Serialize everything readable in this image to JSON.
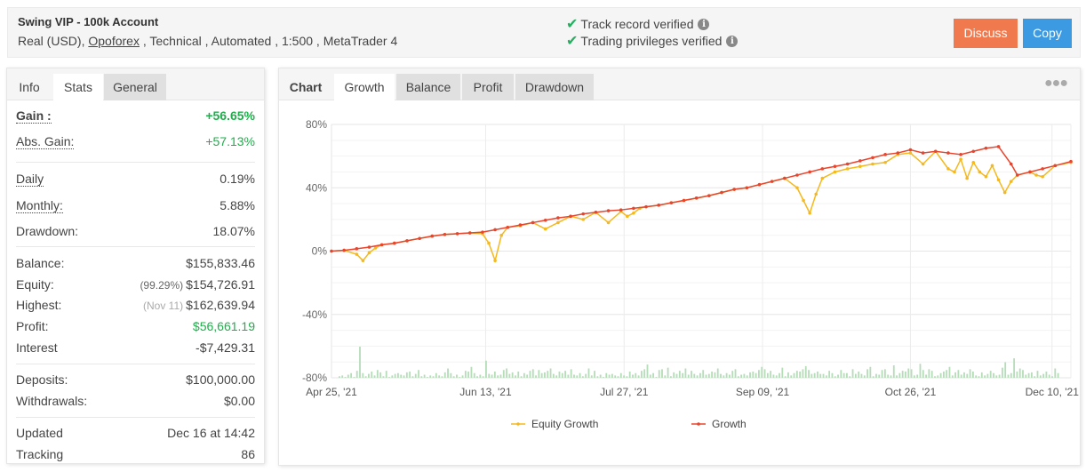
{
  "header": {
    "title": "Swing VIP - 100k Account",
    "subtitle_prefix": "Real (USD), ",
    "broker": "Opoforex",
    "subtitle_suffix": " , Technical , Automated , 1:500 , MetaTrader 4",
    "verifications": [
      {
        "label": "Track record verified",
        "icon": "check-icon"
      },
      {
        "label": "Trading privileges verified",
        "icon": "check-icon"
      }
    ],
    "discuss_label": "Discuss",
    "copy_label": "Copy",
    "colors": {
      "discuss": "#f07a4e",
      "copy": "#3b9ae1",
      "check": "#27ae60"
    }
  },
  "stats_panel": {
    "tabs": [
      {
        "label": "Info",
        "state": "label"
      },
      {
        "label": "Stats",
        "state": "active"
      },
      {
        "label": "General",
        "state": "inactive"
      }
    ],
    "gain": {
      "label": "Gain :",
      "value": "+56.65%"
    },
    "abs_gain": {
      "label": "Abs. Gain:",
      "value": "+57.13%"
    },
    "daily": {
      "label": "Daily",
      "value": "0.19%"
    },
    "monthly": {
      "label": "Monthly:",
      "value": "5.88%"
    },
    "drawdown": {
      "label": "Drawdown:",
      "value": "18.07%"
    },
    "balance": {
      "label": "Balance:",
      "value": "$155,833.46"
    },
    "equity": {
      "label": "Equity:",
      "note": "(99.29%)",
      "value": "$154,726.91"
    },
    "highest": {
      "label": "Highest:",
      "note": "(Nov 11)",
      "value": "$162,639.94"
    },
    "profit": {
      "label": "Profit:",
      "value": "$56,661.19"
    },
    "interest": {
      "label": "Interest",
      "value": "-$7,429.31"
    },
    "deposits": {
      "label": "Deposits:",
      "value": "$100,000.00"
    },
    "withdrawals": {
      "label": "Withdrawals:",
      "value": "$0.00"
    },
    "updated": {
      "label": "Updated",
      "value": "Dec 16 at 14:42"
    },
    "tracking": {
      "label": "Tracking",
      "value": "86"
    }
  },
  "chart_panel": {
    "tabs": [
      {
        "label": "Chart",
        "state": "label"
      },
      {
        "label": "Growth",
        "state": "active"
      },
      {
        "label": "Balance",
        "state": "inactive"
      },
      {
        "label": "Profit",
        "state": "inactive"
      },
      {
        "label": "Drawdown",
        "state": "inactive"
      }
    ],
    "more_icon": "ellipsis-icon"
  },
  "chart_data": {
    "type": "line",
    "title": "",
    "xlabel": "",
    "ylabel": "",
    "ylim": [
      -80,
      80
    ],
    "yticks": [
      "80%",
      "40%",
      "0%",
      "-40%",
      "-80%"
    ],
    "ytick_values": [
      80,
      40,
      0,
      -40,
      -80
    ],
    "xticks": [
      "Apr 25, '21",
      "Jun 13, '21",
      "Jul 27, '21",
      "Sep 09, '21",
      "Oct 26, '21",
      "Dec 10, '21"
    ],
    "xtick_days": [
      0,
      49,
      93,
      137,
      184,
      229
    ],
    "x_range_days": [
      0,
      235
    ],
    "grid": true,
    "legend": {
      "position": "bottom",
      "entries": [
        {
          "name": "Equity Growth",
          "color": "#f5b91e"
        },
        {
          "name": "Growth",
          "color": "#e8452e"
        }
      ]
    },
    "series": [
      {
        "name": "Growth",
        "color": "#e8452e",
        "x_days": [
          0,
          4,
          8,
          12,
          16,
          20,
          24,
          28,
          32,
          36,
          40,
          44,
          48,
          52,
          56,
          60,
          64,
          68,
          72,
          76,
          80,
          84,
          88,
          92,
          96,
          100,
          104,
          108,
          112,
          116,
          120,
          124,
          128,
          132,
          136,
          140,
          144,
          148,
          152,
          156,
          160,
          164,
          168,
          172,
          176,
          180,
          184,
          188,
          192,
          196,
          200,
          204,
          208,
          212,
          216,
          218,
          222,
          226,
          230,
          235
        ],
        "values": [
          0,
          0.5,
          1.5,
          2.5,
          4,
          5,
          6.5,
          8,
          9.5,
          10.5,
          11,
          11.5,
          12,
          13.5,
          15,
          16.5,
          18,
          19.5,
          21,
          22,
          23.5,
          24.5,
          25.5,
          26,
          27,
          28,
          29,
          30.5,
          32,
          33.5,
          35,
          37,
          39,
          40,
          42,
          44,
          46,
          48,
          50,
          52,
          53.5,
          55,
          57,
          59,
          61,
          62,
          64,
          62,
          63,
          62,
          61,
          63,
          65,
          66,
          55,
          48,
          50,
          52,
          54,
          56.6
        ]
      },
      {
        "name": "Equity Growth",
        "color": "#f5b91e",
        "x_days": [
          0,
          4,
          8,
          10,
          12,
          14,
          16,
          20,
          24,
          28,
          32,
          36,
          40,
          44,
          48,
          50,
          52,
          54,
          56,
          60,
          64,
          68,
          72,
          76,
          80,
          84,
          88,
          92,
          94,
          96,
          98,
          100,
          104,
          108,
          112,
          116,
          120,
          124,
          128,
          132,
          136,
          140,
          144,
          148,
          150,
          152,
          154,
          156,
          160,
          164,
          168,
          172,
          176,
          180,
          184,
          188,
          192,
          196,
          198,
          200,
          202,
          204,
          206,
          208,
          210,
          212,
          214,
          216,
          218,
          222,
          224,
          226,
          230,
          235
        ],
        "values": [
          0,
          0.5,
          -2,
          -6,
          -1,
          2,
          4,
          5,
          6.5,
          8,
          9.5,
          10.5,
          11,
          11.5,
          11,
          5,
          -6,
          10,
          15,
          16,
          18,
          14,
          18,
          22,
          20,
          24.5,
          18,
          25,
          22,
          24,
          27,
          28,
          29,
          30.5,
          32,
          33.5,
          35,
          37,
          39,
          40,
          42,
          44,
          46,
          40,
          32,
          24,
          36,
          46,
          50,
          52,
          53.5,
          55,
          56,
          61,
          62,
          55,
          63,
          52,
          50,
          58,
          46,
          56,
          50,
          47,
          54,
          45,
          37,
          44,
          48,
          50,
          48,
          47,
          54,
          56
        ]
      }
    ],
    "volume_bars": {
      "color": "#b5ddb8",
      "note": "daily activity bars along bottom, heights relative",
      "values": [
        2,
        3,
        1,
        4,
        6,
        1,
        9,
        40,
        6,
        2,
        5,
        8,
        3,
        10,
        7,
        2,
        9,
        1,
        3,
        5,
        6,
        4,
        3,
        7,
        8,
        2,
        5,
        10,
        2,
        4,
        1,
        3,
        2,
        6,
        3,
        2,
        7,
        12,
        6,
        2,
        4,
        1,
        3,
        9,
        8,
        14,
        6,
        2,
        4,
        2,
        22,
        5,
        4,
        8,
        3,
        4,
        10,
        12,
        5,
        7,
        3,
        8,
        2,
        6,
        4,
        9,
        11,
        3,
        10,
        6,
        7,
        9,
        12,
        5,
        3,
        8,
        6,
        9,
        4,
        11,
        4,
        3,
        6,
        2,
        5,
        12,
        3,
        9,
        2,
        4,
        1,
        6,
        4,
        5,
        3,
        2,
        6,
        3,
        2,
        8,
        4,
        6,
        3,
        9,
        11,
        17,
        4,
        6,
        1,
        10,
        11,
        3,
        13,
        2,
        7,
        5,
        9,
        6,
        12,
        4,
        9,
        5,
        3,
        6,
        10,
        4,
        5,
        8,
        7,
        12,
        5,
        3,
        6,
        4,
        9,
        11,
        2,
        4,
        5,
        3,
        7,
        8,
        6,
        10,
        14,
        11,
        6,
        9,
        4,
        3,
        6,
        13,
        2,
        7,
        3,
        6,
        9,
        8,
        11,
        15,
        10,
        5,
        6,
        8,
        5,
        5,
        3,
        9,
        6,
        2,
        4,
        10,
        6,
        6,
        2,
        11,
        5,
        8,
        5,
        3,
        11,
        14,
        2,
        5,
        4,
        10,
        11,
        4,
        3,
        16,
        3,
        6,
        9,
        8,
        12,
        11,
        3,
        4,
        18,
        10,
        4,
        11,
        9,
        2,
        3,
        6,
        8,
        10,
        14,
        3,
        7,
        10,
        4,
        7,
        5,
        11,
        8,
        3,
        2,
        7,
        3,
        5,
        9,
        6,
        3,
        4,
        13,
        20,
        4,
        6,
        25,
        8,
        12,
        10,
        4,
        6,
        7,
        2,
        9,
        3,
        5,
        8,
        4,
        2,
        12,
        6
      ]
    }
  }
}
